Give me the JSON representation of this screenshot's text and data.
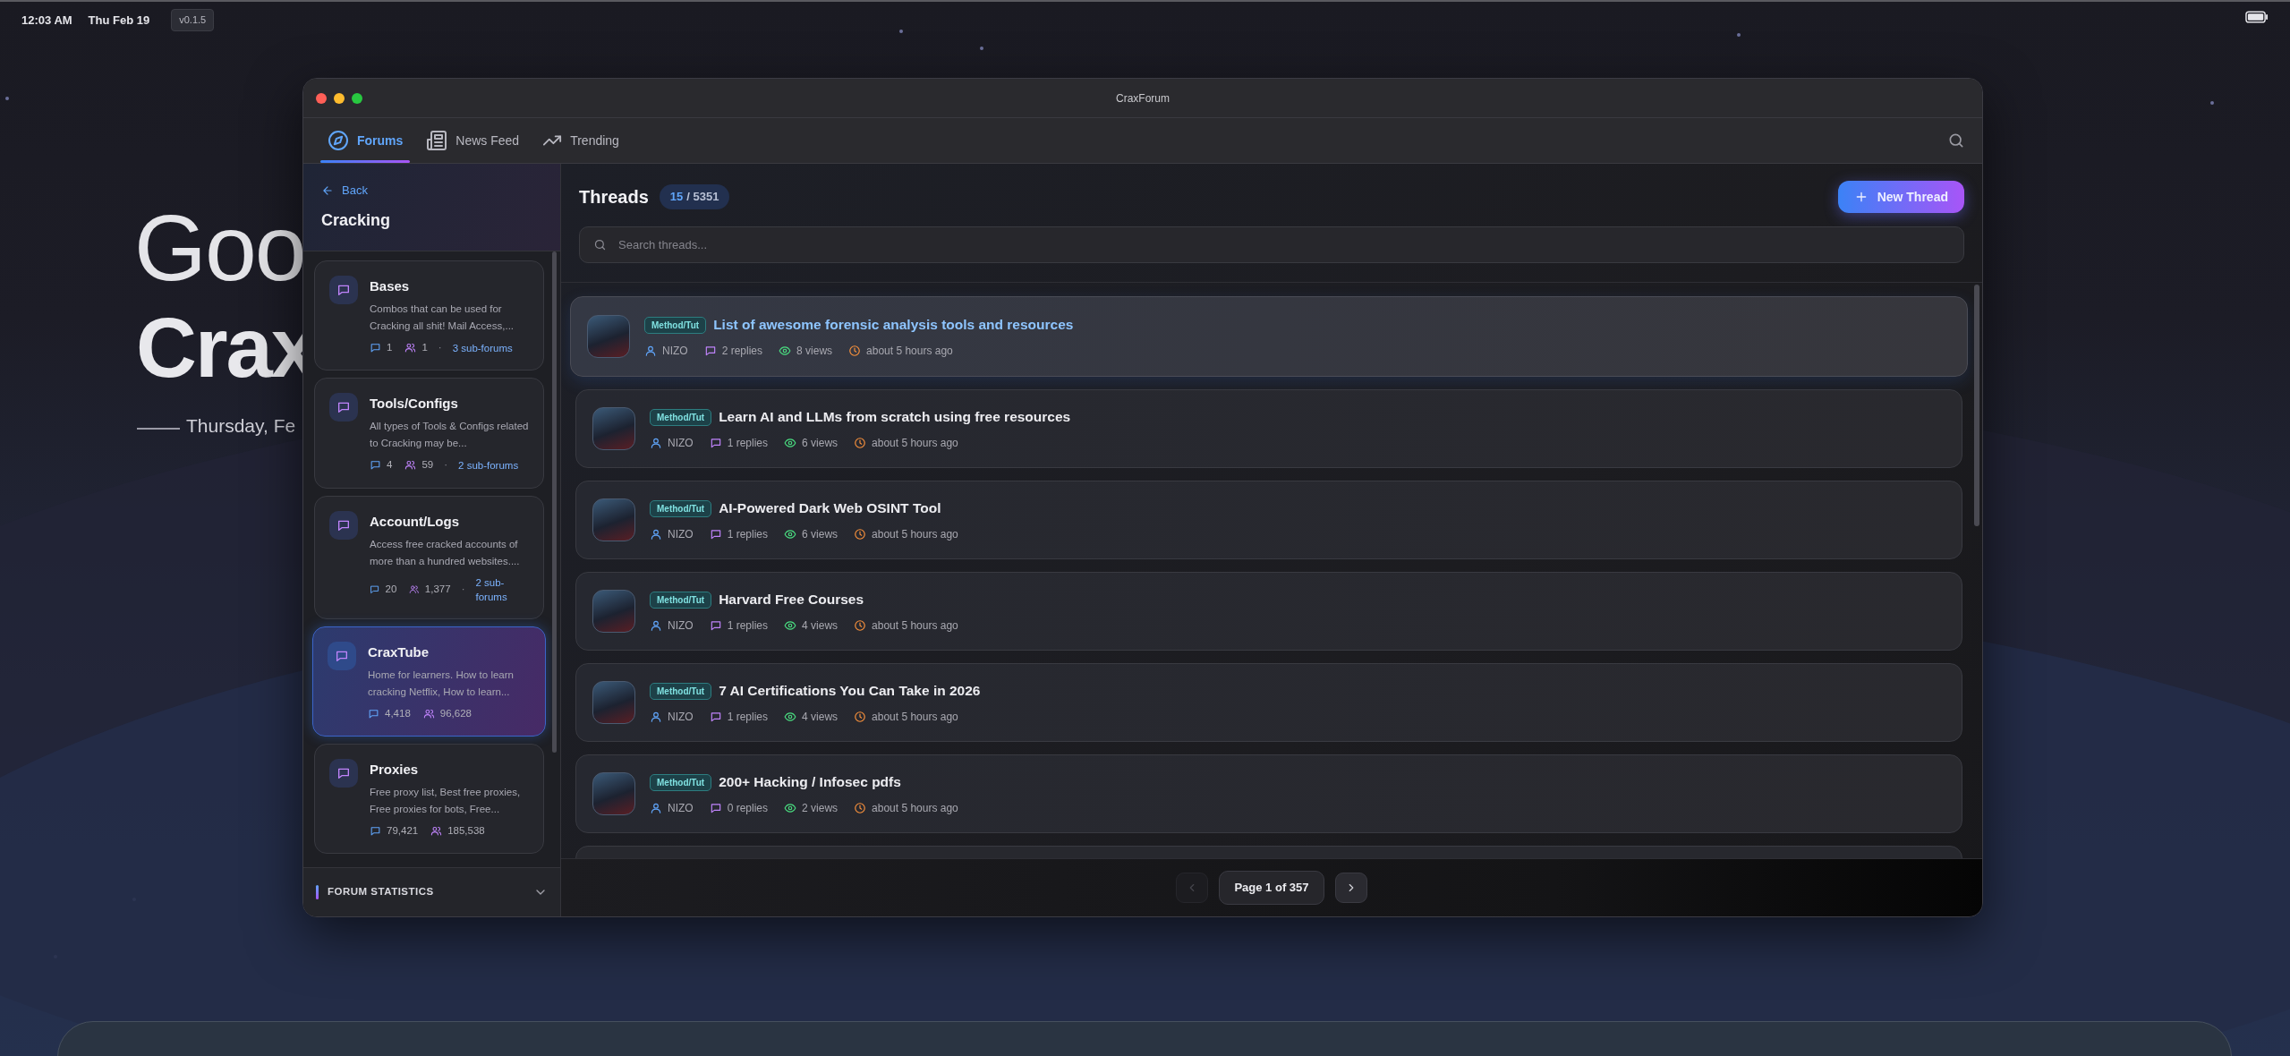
{
  "status_bar": {
    "time": "12:03 AM",
    "date": "Thu Feb 19",
    "version": "v0.1.5"
  },
  "background": {
    "greeting": "Goo",
    "name": "Crax",
    "date": "Thursday, Fe"
  },
  "window": {
    "title": "CraxForum"
  },
  "tabs": [
    {
      "label": "Forums",
      "kind": "compass",
      "selected": true
    },
    {
      "label": "News Feed",
      "kind": "newspaper",
      "selected": false
    },
    {
      "label": "Trending",
      "kind": "trend",
      "selected": false
    }
  ],
  "sidebar": {
    "back": "Back",
    "title": "Cracking",
    "forums": [
      {
        "name": "Bases",
        "description": "Combos that can be used for Cracking all shit! Mail Access,...",
        "threads": "1",
        "posts": "1",
        "separator": "·",
        "subforums": "3 sub-forums",
        "selected": false
      },
      {
        "name": "Tools/Configs",
        "description": "All types of Tools & Configs related to Cracking may be...",
        "threads": "4",
        "posts": "59",
        "separator": "·",
        "subforums": "2 sub-forums",
        "selected": false
      },
      {
        "name": "Account/Logs",
        "description": "Access free cracked accounts of more than a hundred websites....",
        "threads": "20",
        "posts": "1,377",
        "separator": "·",
        "subforums": "2 sub-forums",
        "selected": false
      },
      {
        "name": "CraxTube",
        "description": "Home for learners. How to learn cracking Netflix, How to learn...",
        "threads": "4,418",
        "posts": "96,628",
        "selected": true
      },
      {
        "name": "Proxies",
        "description": "Free proxy list, Best free proxies, Free proxies for bots, Free...",
        "threads": "79,421",
        "posts": "185,538",
        "selected": false
      }
    ],
    "footer": {
      "label": "FORUM STATISTICS",
      "expanded": false
    }
  },
  "main": {
    "title": "Threads",
    "shown": "15",
    "total": "/ 5351",
    "new_button": "New Thread",
    "search": {
      "placeholder": "Search threads..."
    },
    "threads": [
      {
        "tag": "Method/Tut",
        "title": "List of awesome forensic analysis tools and resources",
        "author": "NIZO",
        "replies": "2 replies",
        "views": "8 views",
        "time": "about 5 hours ago",
        "selected": true
      },
      {
        "tag": "Method/Tut",
        "title": "Learn AI and LLMs from scratch using free resources",
        "author": "NIZO",
        "replies": "1 replies",
        "views": "6 views",
        "time": "about 5 hours ago",
        "selected": false
      },
      {
        "tag": "Method/Tut",
        "title": "AI-Powered Dark Web OSINT Tool",
        "author": "NIZO",
        "replies": "1 replies",
        "views": "6 views",
        "time": "about 5 hours ago",
        "selected": false
      },
      {
        "tag": "Method/Tut",
        "title": "Harvard Free Courses",
        "author": "NIZO",
        "replies": "1 replies",
        "views": "4 views",
        "time": "about 5 hours ago",
        "selected": false
      },
      {
        "tag": "Method/Tut",
        "title": "7 AI Certifications You Can Take in 2026",
        "author": "NIZO",
        "replies": "1 replies",
        "views": "4 views",
        "time": "about 5 hours ago",
        "selected": false
      },
      {
        "tag": "Method/Tut",
        "title": "200+ Hacking / Infosec pdfs",
        "author": "NIZO",
        "replies": "0 replies",
        "views": "2 views",
        "time": "about 5 hours ago",
        "selected": false
      }
    ],
    "pagination": {
      "label": "Page 1 of 357",
      "prev_disabled": true,
      "next_disabled": false
    }
  }
}
